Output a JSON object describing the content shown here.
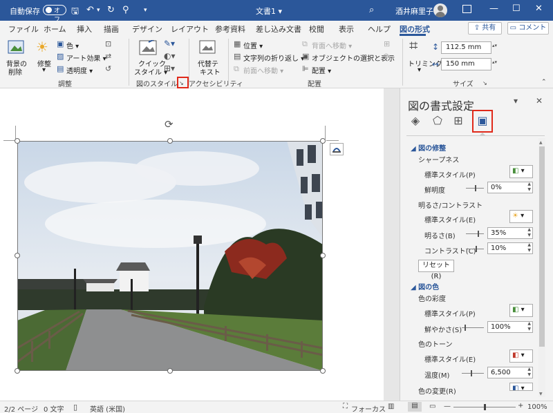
{
  "titlebar": {
    "autosave_label": "自動保存",
    "autosave_state": "オフ",
    "doc_title": "文書1 ▾",
    "user_name": "酒井麻里子"
  },
  "tabs": [
    {
      "label": "ファイル"
    },
    {
      "label": "ホーム"
    },
    {
      "label": "挿入"
    },
    {
      "label": "描画"
    },
    {
      "label": "デザイン"
    },
    {
      "label": "レイアウト"
    },
    {
      "label": "参考資料"
    },
    {
      "label": "差し込み文書"
    },
    {
      "label": "校閲"
    },
    {
      "label": "表示"
    },
    {
      "label": "ヘルプ"
    },
    {
      "label": "図の形式"
    }
  ],
  "share_label": "共有",
  "comment_label": "コメント",
  "ribbon": {
    "remove_bg": [
      "背景の",
      "削除"
    ],
    "corrections": "修整",
    "color": "色 ▾",
    "art_effects": "アート効果 ▾",
    "transparency": "透明度 ▾",
    "quick_styles": [
      "クイック",
      "スタイル ▾"
    ],
    "alt_text": [
      "代替テ",
      "キスト"
    ],
    "position": "位置 ▾",
    "wrap_text": "文字列の折り返し ▾",
    "bring_forward": "前面へ移動 ▾",
    "send_backward": "背面へ移動 ▾",
    "selection_pane": "オブジェクトの選択と表示",
    "align": "配置 ▾",
    "crop": "トリミング",
    "height": "112.5 mm",
    "width": "150 mm",
    "groups": {
      "adjust": "調整",
      "picture_styles": "図のスタイル",
      "accessibility": "アクセシビリティ",
      "arrange": "配置",
      "size": "サイズ"
    }
  },
  "pane": {
    "title": "図の書式設定",
    "sec_corrections": "図の修整",
    "sharpness": "シャープネス",
    "preset": "標準スタイル(P)",
    "sharpen": "鮮明度",
    "sharpen_val": "0%",
    "brightness_contrast": "明るさ/コントラスト",
    "preset_e": "標準スタイル(E)",
    "brightness": "明るさ(B)",
    "brightness_val": "35%",
    "contrast": "コントラスト(C)",
    "contrast_val": "10%",
    "reset": "リセット(R)",
    "sec_color": "図の色",
    "saturation_head": "色の彩度",
    "preset_p2": "標準スタイル(P)",
    "saturation": "鮮やかさ(S)",
    "saturation_val": "100%",
    "tone_head": "色のトーン",
    "preset_e2": "標準スタイル(E)",
    "temperature": "温度(M)",
    "temperature_val": "6,500",
    "recolor": "色の変更(R)"
  },
  "status": {
    "page": "2/2 ページ",
    "words": "0 文字",
    "language": "英語 (米国)",
    "focus": "フォーカス",
    "zoom": "100%"
  }
}
